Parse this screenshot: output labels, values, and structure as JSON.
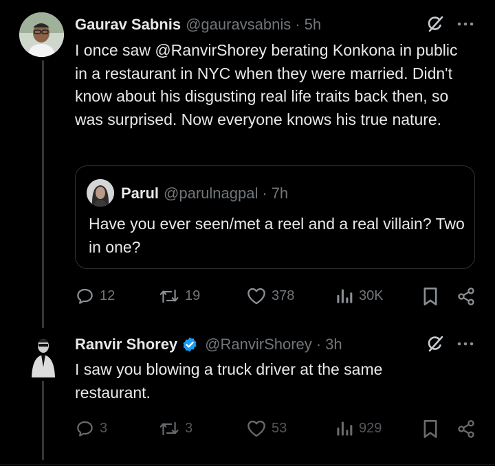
{
  "tweet1": {
    "name": "Gaurav Sabnis",
    "handle": "@gauravsabnis",
    "sep": "·",
    "time": "5h",
    "text": "I once saw @RanvirShorey berating Konkona in public in a restaurant in NYC when they were married. Didn't know about his disgusting real life traits back then, so was surprised. Now everyone knows his true nature.",
    "quote": {
      "name": "Parul",
      "handle": "@parulnagpal",
      "sep": "·",
      "time": "7h",
      "text": "Have you ever seen/met a reel and a real villain? Two in one?"
    },
    "stats": {
      "replies": "12",
      "reposts": "19",
      "likes": "378",
      "views": "30K"
    }
  },
  "tweet2": {
    "name": "Ranvir Shorey",
    "handle": "@RanvirShorey",
    "sep": "·",
    "time": "3h",
    "text": "I saw you blowing a truck driver at the same restaurant.",
    "stats": {
      "replies": "3",
      "reposts": "3",
      "likes": "53",
      "views": "929"
    }
  },
  "icons": {
    "grok": "grok-slash-icon",
    "more": "more-dots-icon",
    "reply": "reply-bubble-icon",
    "repost": "repost-icon",
    "like": "heart-icon",
    "views": "views-bars-icon",
    "bookmark": "bookmark-icon",
    "share": "share-icon",
    "verified": "verified-badge-icon"
  },
  "colors": {
    "background": "#000000",
    "text": "#e7e9ea",
    "muted": "#71767b",
    "verified": "#1d9bf0",
    "border": "#2f3336"
  }
}
